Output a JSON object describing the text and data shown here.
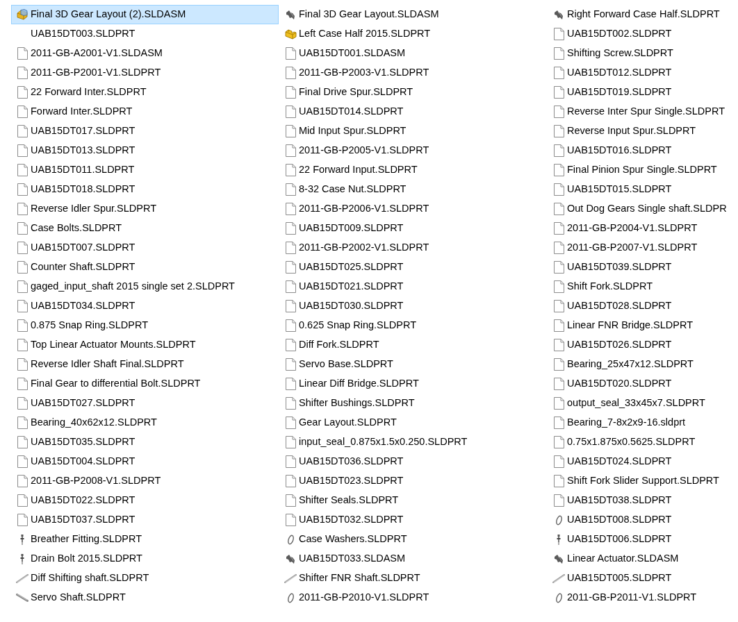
{
  "columns": [
    {
      "files": [
        {
          "name": "Final 3D Gear Layout (2).SLDASM",
          "kind": "assembly",
          "selected": true
        },
        {
          "name": "UAB15DT003.SLDPRT",
          "kind": "blank",
          "selected": false
        },
        {
          "name": "2011-GB-A2001-V1.SLDASM",
          "kind": "document",
          "selected": false
        },
        {
          "name": "2011-GB-P2001-V1.SLDPRT",
          "kind": "document",
          "selected": false
        },
        {
          "name": "22 Forward Inter.SLDPRT",
          "kind": "document",
          "selected": false
        },
        {
          "name": "Forward Inter.SLDPRT",
          "kind": "document",
          "selected": false
        },
        {
          "name": "UAB15DT017.SLDPRT",
          "kind": "document",
          "selected": false
        },
        {
          "name": "UAB15DT013.SLDPRT",
          "kind": "document",
          "selected": false
        },
        {
          "name": "UAB15DT011.SLDPRT",
          "kind": "document",
          "selected": false
        },
        {
          "name": "UAB15DT018.SLDPRT",
          "kind": "document",
          "selected": false
        },
        {
          "name": "Reverse Idler Spur.SLDPRT",
          "kind": "document",
          "selected": false
        },
        {
          "name": "Case Bolts.SLDPRT",
          "kind": "document",
          "selected": false
        },
        {
          "name": "UAB15DT007.SLDPRT",
          "kind": "document",
          "selected": false
        },
        {
          "name": "Counter Shaft.SLDPRT",
          "kind": "document",
          "selected": false
        },
        {
          "name": "gaged_input_shaft 2015 single set 2.SLDPRT",
          "kind": "document",
          "selected": false
        },
        {
          "name": "UAB15DT034.SLDPRT",
          "kind": "document",
          "selected": false
        },
        {
          "name": "0.875 Snap Ring.SLDPRT",
          "kind": "document",
          "selected": false
        },
        {
          "name": "Top Linear Actuator Mounts.SLDPRT",
          "kind": "document",
          "selected": false
        },
        {
          "name": "Reverse Idler Shaft Final.SLDPRT",
          "kind": "document",
          "selected": false
        },
        {
          "name": "Final Gear to differential Bolt.SLDPRT",
          "kind": "document",
          "selected": false
        },
        {
          "name": "UAB15DT027.SLDPRT",
          "kind": "document",
          "selected": false
        },
        {
          "name": "Bearing_40x62x12.SLDPRT",
          "kind": "document",
          "selected": false
        },
        {
          "name": "UAB15DT035.SLDPRT",
          "kind": "document",
          "selected": false
        },
        {
          "name": "UAB15DT004.SLDPRT",
          "kind": "document",
          "selected": false
        },
        {
          "name": "2011-GB-P2008-V1.SLDPRT",
          "kind": "document",
          "selected": false
        },
        {
          "name": "UAB15DT022.SLDPRT",
          "kind": "document",
          "selected": false
        },
        {
          "name": "UAB15DT037.SLDPRT",
          "kind": "document",
          "selected": false
        },
        {
          "name": "Breather Fitting.SLDPRT",
          "kind": "bolt",
          "selected": false
        },
        {
          "name": "Drain Bolt 2015.SLDPRT",
          "kind": "bolt",
          "selected": false
        },
        {
          "name": "Diff Shifting shaft.SLDPRT",
          "kind": "rod",
          "selected": false
        },
        {
          "name": "Servo Shaft.SLDPRT",
          "kind": "shaft",
          "selected": false
        }
      ]
    },
    {
      "files": [
        {
          "name": "Final 3D Gear Layout.SLDASM",
          "kind": "bracket",
          "selected": false
        },
        {
          "name": "Left Case Half 2015.SLDPRT",
          "kind": "part",
          "selected": false
        },
        {
          "name": "UAB15DT001.SLDASM",
          "kind": "document",
          "selected": false
        },
        {
          "name": "2011-GB-P2003-V1.SLDPRT",
          "kind": "document",
          "selected": false
        },
        {
          "name": "Final Drive Spur.SLDPRT",
          "kind": "document",
          "selected": false
        },
        {
          "name": "UAB15DT014.SLDPRT",
          "kind": "document",
          "selected": false
        },
        {
          "name": "Mid Input Spur.SLDPRT",
          "kind": "document",
          "selected": false
        },
        {
          "name": "2011-GB-P2005-V1.SLDPRT",
          "kind": "document",
          "selected": false
        },
        {
          "name": "22 Forward Input.SLDPRT",
          "kind": "document",
          "selected": false
        },
        {
          "name": "8-32 Case Nut.SLDPRT",
          "kind": "document",
          "selected": false
        },
        {
          "name": "2011-GB-P2006-V1.SLDPRT",
          "kind": "document",
          "selected": false
        },
        {
          "name": "UAB15DT009.SLDPRT",
          "kind": "document",
          "selected": false
        },
        {
          "name": "2011-GB-P2002-V1.SLDPRT",
          "kind": "document",
          "selected": false
        },
        {
          "name": "UAB15DT025.SLDPRT",
          "kind": "document",
          "selected": false
        },
        {
          "name": "UAB15DT021.SLDPRT",
          "kind": "document",
          "selected": false
        },
        {
          "name": "UAB15DT030.SLDPRT",
          "kind": "document",
          "selected": false
        },
        {
          "name": "0.625 Snap Ring.SLDPRT",
          "kind": "document",
          "selected": false
        },
        {
          "name": "Diff Fork.SLDPRT",
          "kind": "document",
          "selected": false
        },
        {
          "name": "Servo Base.SLDPRT",
          "kind": "document",
          "selected": false
        },
        {
          "name": "Linear Diff Bridge.SLDPRT",
          "kind": "document",
          "selected": false
        },
        {
          "name": "Shifter Bushings.SLDPRT",
          "kind": "document",
          "selected": false
        },
        {
          "name": "Gear Layout.SLDPRT",
          "kind": "document",
          "selected": false
        },
        {
          "name": "input_seal_0.875x1.5x0.250.SLDPRT",
          "kind": "document",
          "selected": false
        },
        {
          "name": "UAB15DT036.SLDPRT",
          "kind": "document",
          "selected": false
        },
        {
          "name": "UAB15DT023.SLDPRT",
          "kind": "document",
          "selected": false
        },
        {
          "name": "Shifter Seals.SLDPRT",
          "kind": "document",
          "selected": false
        },
        {
          "name": "UAB15DT032.SLDPRT",
          "kind": "document",
          "selected": false
        },
        {
          "name": "Case Washers.SLDPRT",
          "kind": "ring",
          "selected": false
        },
        {
          "name": "UAB15DT033.SLDASM",
          "kind": "bracket",
          "selected": false
        },
        {
          "name": "Shifter FNR Shaft.SLDPRT",
          "kind": "rod",
          "selected": false
        },
        {
          "name": "2011-GB-P2010-V1.SLDPRT",
          "kind": "ring",
          "selected": false
        }
      ]
    },
    {
      "files": [
        {
          "name": "Right Forward Case Half.SLDPRT",
          "kind": "bracket",
          "selected": false
        },
        {
          "name": "UAB15DT002.SLDPRT",
          "kind": "document",
          "selected": false
        },
        {
          "name": "Shifting Screw.SLDPRT",
          "kind": "document",
          "selected": false
        },
        {
          "name": "UAB15DT012.SLDPRT",
          "kind": "document",
          "selected": false
        },
        {
          "name": "UAB15DT019.SLDPRT",
          "kind": "document",
          "selected": false
        },
        {
          "name": "Reverse Inter Spur Single.SLDPRT",
          "kind": "document",
          "selected": false
        },
        {
          "name": "Reverse Input Spur.SLDPRT",
          "kind": "document",
          "selected": false
        },
        {
          "name": "UAB15DT016.SLDPRT",
          "kind": "document",
          "selected": false
        },
        {
          "name": "Final Pinion Spur Single.SLDPRT",
          "kind": "document",
          "selected": false
        },
        {
          "name": "UAB15DT015.SLDPRT",
          "kind": "document",
          "selected": false
        },
        {
          "name": "Out Dog Gears Single shaft.SLDPR",
          "kind": "document",
          "selected": false
        },
        {
          "name": "2011-GB-P2004-V1.SLDPRT",
          "kind": "document",
          "selected": false
        },
        {
          "name": "2011-GB-P2007-V1.SLDPRT",
          "kind": "document",
          "selected": false
        },
        {
          "name": "UAB15DT039.SLDPRT",
          "kind": "document",
          "selected": false
        },
        {
          "name": "Shift Fork.SLDPRT",
          "kind": "document",
          "selected": false
        },
        {
          "name": "UAB15DT028.SLDPRT",
          "kind": "document",
          "selected": false
        },
        {
          "name": "Linear FNR Bridge.SLDPRT",
          "kind": "document",
          "selected": false
        },
        {
          "name": "UAB15DT026.SLDPRT",
          "kind": "document",
          "selected": false
        },
        {
          "name": "Bearing_25x47x12.SLDPRT",
          "kind": "document",
          "selected": false
        },
        {
          "name": "UAB15DT020.SLDPRT",
          "kind": "document",
          "selected": false
        },
        {
          "name": "output_seal_33x45x7.SLDPRT",
          "kind": "document",
          "selected": false
        },
        {
          "name": "Bearing_7-8x2x9-16.sldprt",
          "kind": "document",
          "selected": false
        },
        {
          "name": "0.75x1.875x0.5625.SLDPRT",
          "kind": "document",
          "selected": false
        },
        {
          "name": "UAB15DT024.SLDPRT",
          "kind": "document",
          "selected": false
        },
        {
          "name": "Shift Fork Slider Support.SLDPRT",
          "kind": "document",
          "selected": false
        },
        {
          "name": "UAB15DT038.SLDPRT",
          "kind": "document",
          "selected": false
        },
        {
          "name": "UAB15DT008.SLDPRT",
          "kind": "ring",
          "selected": false
        },
        {
          "name": "UAB15DT006.SLDPRT",
          "kind": "bolt",
          "selected": false
        },
        {
          "name": "Linear Actuator.SLDASM",
          "kind": "bracket",
          "selected": false
        },
        {
          "name": "UAB15DT005.SLDPRT",
          "kind": "rod",
          "selected": false
        },
        {
          "name": "2011-GB-P2011-V1.SLDPRT",
          "kind": "ring",
          "selected": false
        }
      ]
    }
  ]
}
